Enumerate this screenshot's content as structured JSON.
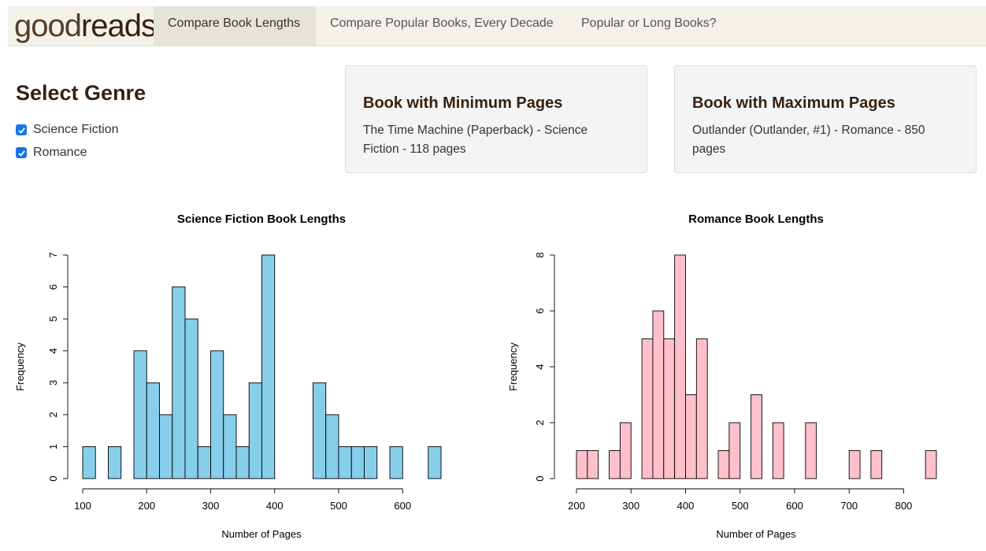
{
  "brand": {
    "light": "good",
    "bold": "reads"
  },
  "nav": {
    "tabs": [
      {
        "label": "Compare Book Lengths"
      },
      {
        "label": "Compare Popular Books, Every Decade"
      },
      {
        "label": "Popular or Long Books?"
      }
    ]
  },
  "sidebar": {
    "title": "Select Genre",
    "genres": [
      {
        "label": "Science Fiction",
        "checked": true
      },
      {
        "label": "Romance",
        "checked": true
      }
    ]
  },
  "cards": {
    "min": {
      "title": "Book with Minimum Pages",
      "text": "The Time Machine (Paperback) - Science Fiction - 118 pages"
    },
    "max": {
      "title": "Book with Maximum Pages",
      "text": "Outlander (Outlander, #1) - Romance - 850 pages"
    }
  },
  "colors": {
    "scifi": "#87ceeb",
    "romance": "#ffc0cb",
    "brand": "#382110",
    "check": "#1a73e8"
  },
  "chart_data": [
    {
      "type": "bar",
      "title": "Science Fiction Book Lengths",
      "xlabel": "Number of Pages",
      "ylabel": "Frequency",
      "xlim": [
        100,
        660
      ],
      "ylim": [
        0,
        7
      ],
      "xticks": [
        100,
        200,
        300,
        400,
        500,
        600
      ],
      "yticks": [
        0,
        1,
        2,
        3,
        4,
        5,
        6,
        7
      ],
      "bin_width": 20,
      "fill": "#87ceeb",
      "bins": [
        {
          "start": 100,
          "count": 1
        },
        {
          "start": 120,
          "count": 0
        },
        {
          "start": 140,
          "count": 1
        },
        {
          "start": 160,
          "count": 0
        },
        {
          "start": 180,
          "count": 4
        },
        {
          "start": 200,
          "count": 3
        },
        {
          "start": 220,
          "count": 2
        },
        {
          "start": 240,
          "count": 6
        },
        {
          "start": 260,
          "count": 5
        },
        {
          "start": 280,
          "count": 1
        },
        {
          "start": 300,
          "count": 4
        },
        {
          "start": 320,
          "count": 2
        },
        {
          "start": 340,
          "count": 1
        },
        {
          "start": 360,
          "count": 3
        },
        {
          "start": 380,
          "count": 7
        },
        {
          "start": 400,
          "count": 0
        },
        {
          "start": 420,
          "count": 0
        },
        {
          "start": 440,
          "count": 0
        },
        {
          "start": 460,
          "count": 3
        },
        {
          "start": 480,
          "count": 2
        },
        {
          "start": 500,
          "count": 1
        },
        {
          "start": 520,
          "count": 1
        },
        {
          "start": 540,
          "count": 1
        },
        {
          "start": 560,
          "count": 0
        },
        {
          "start": 580,
          "count": 1
        },
        {
          "start": 600,
          "count": 0
        },
        {
          "start": 620,
          "count": 0
        },
        {
          "start": 640,
          "count": 1
        }
      ]
    },
    {
      "type": "bar",
      "title": "Romance Book Lengths",
      "xlabel": "Number of Pages",
      "ylabel": "Frequency",
      "xlim": [
        200,
        860
      ],
      "ylim": [
        0,
        8
      ],
      "xticks": [
        200,
        300,
        400,
        500,
        600,
        700,
        800
      ],
      "yticks": [
        0,
        2,
        4,
        6,
        8
      ],
      "bin_width": 20,
      "fill": "#ffc0cb",
      "bins": [
        {
          "start": 200,
          "count": 1
        },
        {
          "start": 220,
          "count": 1
        },
        {
          "start": 240,
          "count": 0
        },
        {
          "start": 260,
          "count": 1
        },
        {
          "start": 280,
          "count": 2
        },
        {
          "start": 300,
          "count": 0
        },
        {
          "start": 320,
          "count": 5
        },
        {
          "start": 340,
          "count": 6
        },
        {
          "start": 360,
          "count": 5
        },
        {
          "start": 380,
          "count": 8
        },
        {
          "start": 400,
          "count": 3
        },
        {
          "start": 420,
          "count": 5
        },
        {
          "start": 440,
          "count": 0
        },
        {
          "start": 460,
          "count": 1
        },
        {
          "start": 480,
          "count": 2
        },
        {
          "start": 500,
          "count": 0
        },
        {
          "start": 520,
          "count": 3
        },
        {
          "start": 540,
          "count": 0
        },
        {
          "start": 560,
          "count": 2
        },
        {
          "start": 580,
          "count": 0
        },
        {
          "start": 600,
          "count": 0
        },
        {
          "start": 620,
          "count": 2
        },
        {
          "start": 640,
          "count": 0
        },
        {
          "start": 660,
          "count": 0
        },
        {
          "start": 680,
          "count": 0
        },
        {
          "start": 700,
          "count": 1
        },
        {
          "start": 720,
          "count": 0
        },
        {
          "start": 740,
          "count": 1
        },
        {
          "start": 760,
          "count": 0
        },
        {
          "start": 780,
          "count": 0
        },
        {
          "start": 800,
          "count": 0
        },
        {
          "start": 820,
          "count": 0
        },
        {
          "start": 840,
          "count": 1
        }
      ]
    }
  ]
}
